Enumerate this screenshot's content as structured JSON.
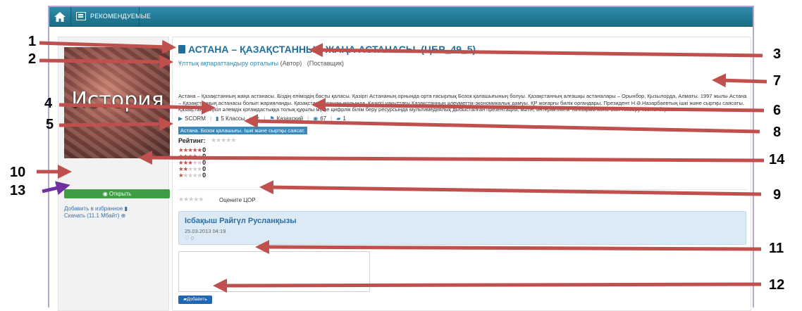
{
  "navbar": {
    "recommended_label": "РЕКОМЕНДУЕМЫЕ"
  },
  "cover": {
    "title": "История"
  },
  "sidebar": {
    "open_button": "Открыть",
    "open_icon": "eye-icon",
    "favorite_link": "Добавить в избранное",
    "favorite_icon": "bookmark-icon",
    "download_link": "Скачать (11.1 Мбайт)",
    "download_icon": "info-circle-icon"
  },
  "resource": {
    "title": "АСТАНА – ҚАЗАҚСТАННЫҢ ЖАҢА АСТАНАСЫ. (ЦБР_49_5)",
    "author": "Ұлттық ақпараттандыру орталығы",
    "author_role": "(Автор)",
    "provider_role": "(Поставщик)",
    "description": "Астана – Қазақстанның жаңа астанасы. Біздің еліміздің басты қаласы. Қазіргі Астананың орнында орта ғасырлық Бозок қалашығының болуы. Қазақстанның алғашқы астаналары – Орынбор, Қызылорда, Алматы. 1997 жылы Астана – Қазақстанның астанасы болып жарияланды. Қазақстан болашақ жолында. Қазіргі уақыттағы Қазақстанның әлеуметтік-экономикалық дамуы. ҚР жоғарғы билік органдары. Президент Н.Ә.Назарбаевтың ішкі және сыртқы саясаты. Қазақстан – бүкіл әлемдік қоғамдастыққа толық құқылы мүше цифрлік білім беру ресурсында мультимедиялық дыбысталған презентация, мәтін, интерактивтік тапсырма және өзін тексеру тестісі берілген.",
    "meta": {
      "format": "SCORM",
      "grade": "5 Классы",
      "language": "Казахский",
      "views": "67",
      "comments": "1"
    },
    "tag": "Астана. Бозок қалашығы. Ішкі және сыртқы саясат."
  },
  "rating": {
    "label": "Рейтинг:",
    "rows": [
      {
        "stars": 5,
        "count": "0"
      },
      {
        "stars": 4,
        "count": "0"
      },
      {
        "stars": 3,
        "count": "0"
      },
      {
        "stars": 2,
        "count": "0"
      },
      {
        "stars": 1,
        "count": "0"
      }
    ],
    "rate_label": "Оцените ЦОР"
  },
  "comment": {
    "author": "Ісбақыш Райгүл Русланқызы",
    "date": "25.03.2013 04:19",
    "likes": "0"
  },
  "comment_form": {
    "add_button": "Добавить",
    "add_icon": "comment-icon"
  },
  "annotations": [
    "1",
    "2",
    "3",
    "4",
    "5",
    "6",
    "7",
    "8",
    "9",
    "10",
    "11",
    "12",
    "13",
    "14"
  ],
  "colors": {
    "navbar": "#1f7a96",
    "title": "#1f6f9c",
    "open_button": "#3f9e45",
    "tag": "#3a89b9",
    "comment_bg": "#dbeaf4",
    "add_button": "#1f66b3",
    "arrow_red": "#c0504d",
    "arrow_purple": "#7030a0"
  }
}
